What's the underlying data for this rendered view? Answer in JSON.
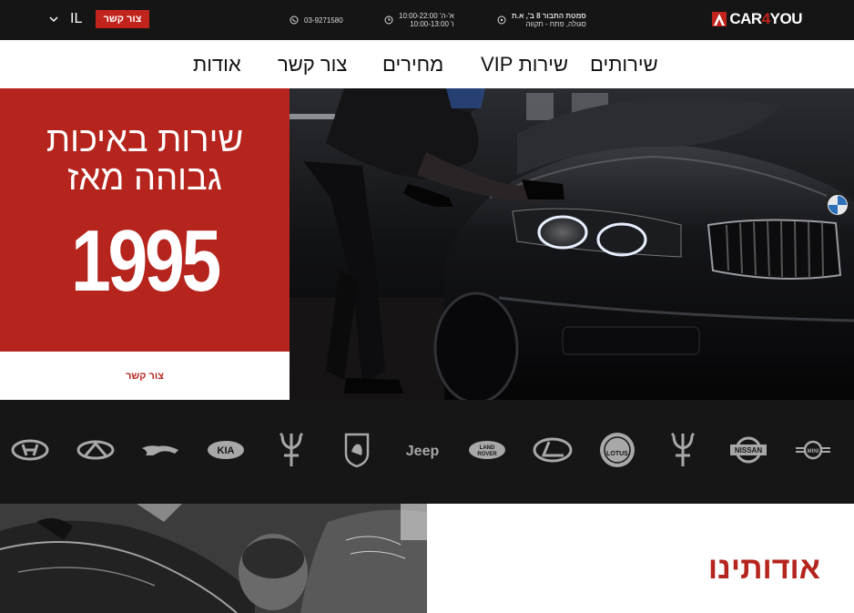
{
  "topbar": {
    "logo_text_a": "CAR",
    "logo_text_b": "4",
    "logo_text_c": "YOU",
    "address_line1": "סמטת התבור 8 ב', א.ת",
    "address_line2": "סגולה, פתח - תקווה",
    "hours_line1": "א'-ה' 10:00-22:00",
    "hours_line2": "ו' 10:00-13:00",
    "phone": "03-9271580",
    "contact_label": "צור קשר",
    "language": "IL"
  },
  "nav": {
    "items": [
      {
        "label": "שירותים"
      },
      {
        "label": "שירות VIP"
      },
      {
        "label": "מחירים"
      },
      {
        "label": "צור קשר"
      },
      {
        "label": "אודות"
      }
    ]
  },
  "hero": {
    "title_line1": "שירות באיכות",
    "title_line2": "גבוהה מאז",
    "year": "1995",
    "cta_label": "צור קשר"
  },
  "brands": [
    "hyundai-logo",
    "infiniti-logo",
    "jaguar-logo",
    "kia-logo",
    "maserati-logo",
    "lamborghini-logo",
    "jeep-logo",
    "land-rover-logo",
    "lexus-logo",
    "lotus-logo",
    "maserati-logo",
    "nissan-logo",
    "mini-logo"
  ],
  "brand_text": {
    "jeep": "Jeep",
    "kia": "KIA",
    "nissan": "NISSAN",
    "land_rover_1": "LAND",
    "land_rover_2": "ROVER",
    "lotus": "LOTUS",
    "mini": "MINI"
  },
  "about": {
    "title": "אודותינו"
  },
  "colors": {
    "accent": "#b5241d",
    "topbar": "#151515",
    "brands_bg": "#161616"
  }
}
